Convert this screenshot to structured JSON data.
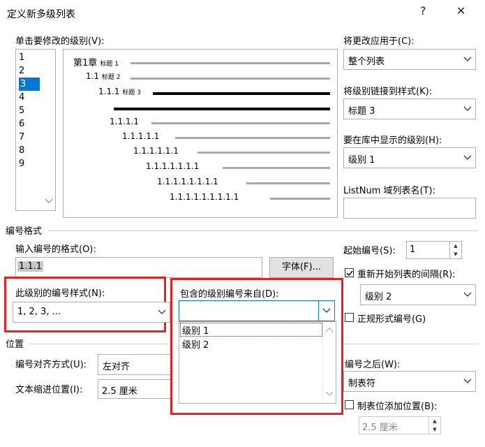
{
  "window": {
    "title": "定义新多级列表",
    "help": "?",
    "close": "✕"
  },
  "levels_label": "单击要修改的级别(V):",
  "levels": [
    "1",
    "2",
    "3",
    "4",
    "5",
    "6",
    "7",
    "8",
    "9"
  ],
  "selected_level": "3",
  "preview": {
    "rows": [
      {
        "num": "第1章",
        "label": "标题 1"
      },
      {
        "num": "1.1",
        "label": "标题 2"
      },
      {
        "num": "1.1.1",
        "label": "标题 3"
      },
      {
        "num": "1.1.1.1",
        "label": ""
      },
      {
        "num": "1.1.1.1.1",
        "label": ""
      },
      {
        "num": "1.1.1.1.1.1",
        "label": ""
      },
      {
        "num": "1.1.1.1.1.1.1",
        "label": ""
      },
      {
        "num": "1.1.1.1.1.1.1.1",
        "label": ""
      },
      {
        "num": "1.1.1.1.1.1.1.1.1",
        "label": ""
      }
    ]
  },
  "apply_to": {
    "label": "将更改应用于(C):",
    "value": "整个列表"
  },
  "link_style": {
    "label": "将级别链接到样式(K):",
    "value": "标题 3"
  },
  "gallery_level": {
    "label": "要在库中显示的级别(H):",
    "value": "级别 1"
  },
  "listnum": {
    "label": "ListNum 域列表名(T):",
    "value": ""
  },
  "numformat_section": "编号格式",
  "format_input": {
    "label": "输入编号的格式(O):",
    "value": "1.1.1"
  },
  "font_button": "字体(F)...",
  "num_style": {
    "label": "此级别的编号样式(N):",
    "value": "1, 2, 3, ..."
  },
  "include_from": {
    "label": "包含的级别编号来自(D):",
    "value": "",
    "options": [
      "级别 1",
      "级别 2"
    ]
  },
  "start_at": {
    "label": "起始编号(S):",
    "value": "1"
  },
  "restart": {
    "label": "重新开始列表的间隔(R):",
    "checked": true,
    "value": "级别 2"
  },
  "legal": {
    "label": "正规形式编号(G)",
    "checked": false
  },
  "position_section": "位置",
  "alignment": {
    "label": "编号对齐方式(U):",
    "value": "左对齐"
  },
  "indent": {
    "label": "文本缩进位置(I):",
    "value": "2.5 厘米"
  },
  "follow": {
    "label": "编号之后(W):",
    "value": "制表符"
  },
  "tab_add": {
    "label": "制表位添加位置(B):",
    "checked": false,
    "value": "2.5 厘米"
  }
}
